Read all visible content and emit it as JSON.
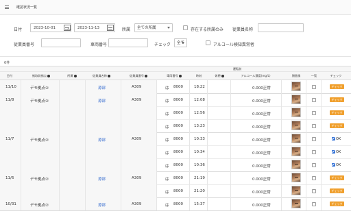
{
  "title": "確認状況一覧",
  "filters": {
    "date_label": "日付",
    "date_from": "2023-10-01",
    "date_sep": "〜",
    "date_to": "2023-11-13",
    "affiliation_label": "所属",
    "affiliation_value": "全ての所属",
    "only_existing_label": "存在する所属のみ",
    "employee_name_label": "従業員名称",
    "employee_name_value": "",
    "employee_no_label": "従業員番号",
    "employee_no_value": "",
    "vehicle_no_label": "車両番号",
    "vehicle_no_value": "",
    "check_label": "チェック",
    "check_value": "全て",
    "alcohol_only_label": "アルコール検知異常者"
  },
  "count_text": "6件",
  "table": {
    "group_header": "運転前",
    "headers": {
      "date": "日付",
      "base": "拠取発拠点",
      "affiliation": "所属",
      "employee_name": "従業員名称",
      "employee_no": "従業員番号",
      "vehicle_no": "車両番号",
      "time": "時刻",
      "memo": "休憩",
      "alcohol": "アルコール濃度(mg/L)",
      "photo": "顔画像",
      "confirm": "一覧",
      "check": "チェック"
    },
    "groups": [
      {
        "date": "11/10",
        "base": "デモ拠点②",
        "employee_name": "源部",
        "employee_no": "A309",
        "rows": [
          {
            "vehicle_kana": "は",
            "vehicle_no": "8000",
            "time": "18:22",
            "alcohol": "0.000正常",
            "status": "badge"
          }
        ]
      },
      {
        "date": "11/8",
        "base": "デモ拠点②",
        "employee_name": "源部",
        "employee_no": "A309",
        "rows": [
          {
            "vehicle_kana": "は",
            "vehicle_no": "8000",
            "time": "12:08",
            "alcohol": "0.000正常",
            "status": "badge"
          },
          {
            "vehicle_kana": "は",
            "vehicle_no": "8000",
            "time": "12:56",
            "alcohol": "0.000正常",
            "status": "badge"
          },
          {
            "vehicle_kana": "は",
            "vehicle_no": "8000",
            "time": "13:23",
            "alcohol": "0.000正常",
            "status": "badge"
          }
        ]
      },
      {
        "date": "11/7",
        "base": "デモ拠点②",
        "employee_name": "源部",
        "employee_no": "A309",
        "rows": [
          {
            "vehicle_kana": "は",
            "vehicle_no": "8000",
            "time": "10:33",
            "alcohol": "0.000正常",
            "status": "ok"
          },
          {
            "vehicle_kana": "は",
            "vehicle_no": "8000",
            "time": "10:34",
            "alcohol": "0.000正常",
            "status": "ok"
          },
          {
            "vehicle_kana": "は",
            "vehicle_no": "8000",
            "time": "10:36",
            "alcohol": "0.000正常",
            "status": "ok"
          }
        ]
      },
      {
        "date": "11/6",
        "base": "デモ拠点②",
        "employee_name": "源部",
        "employee_no": "A309",
        "rows": [
          {
            "vehicle_kana": "は",
            "vehicle_no": "8000",
            "time": "21:19",
            "alcohol": "0.000正常",
            "status": "badge"
          },
          {
            "vehicle_kana": "は",
            "vehicle_no": "8000",
            "time": "21:20",
            "alcohol": "0.000正常",
            "status": "badge"
          }
        ]
      },
      {
        "date": "10/31",
        "base": "デモ拠点②",
        "employee_name": "源部",
        "employee_no": "A309",
        "rows": [
          {
            "vehicle_kana": "は",
            "vehicle_no": "8000",
            "time": "15:37",
            "alcohol": "0.000正常",
            "status": "badge"
          }
        ]
      }
    ],
    "badge_label": "チェック",
    "ok_label": "OK"
  },
  "colors": {
    "badge": "#f0a02e",
    "link": "#3a6fd0",
    "ok_check": "#2f6fd6"
  }
}
